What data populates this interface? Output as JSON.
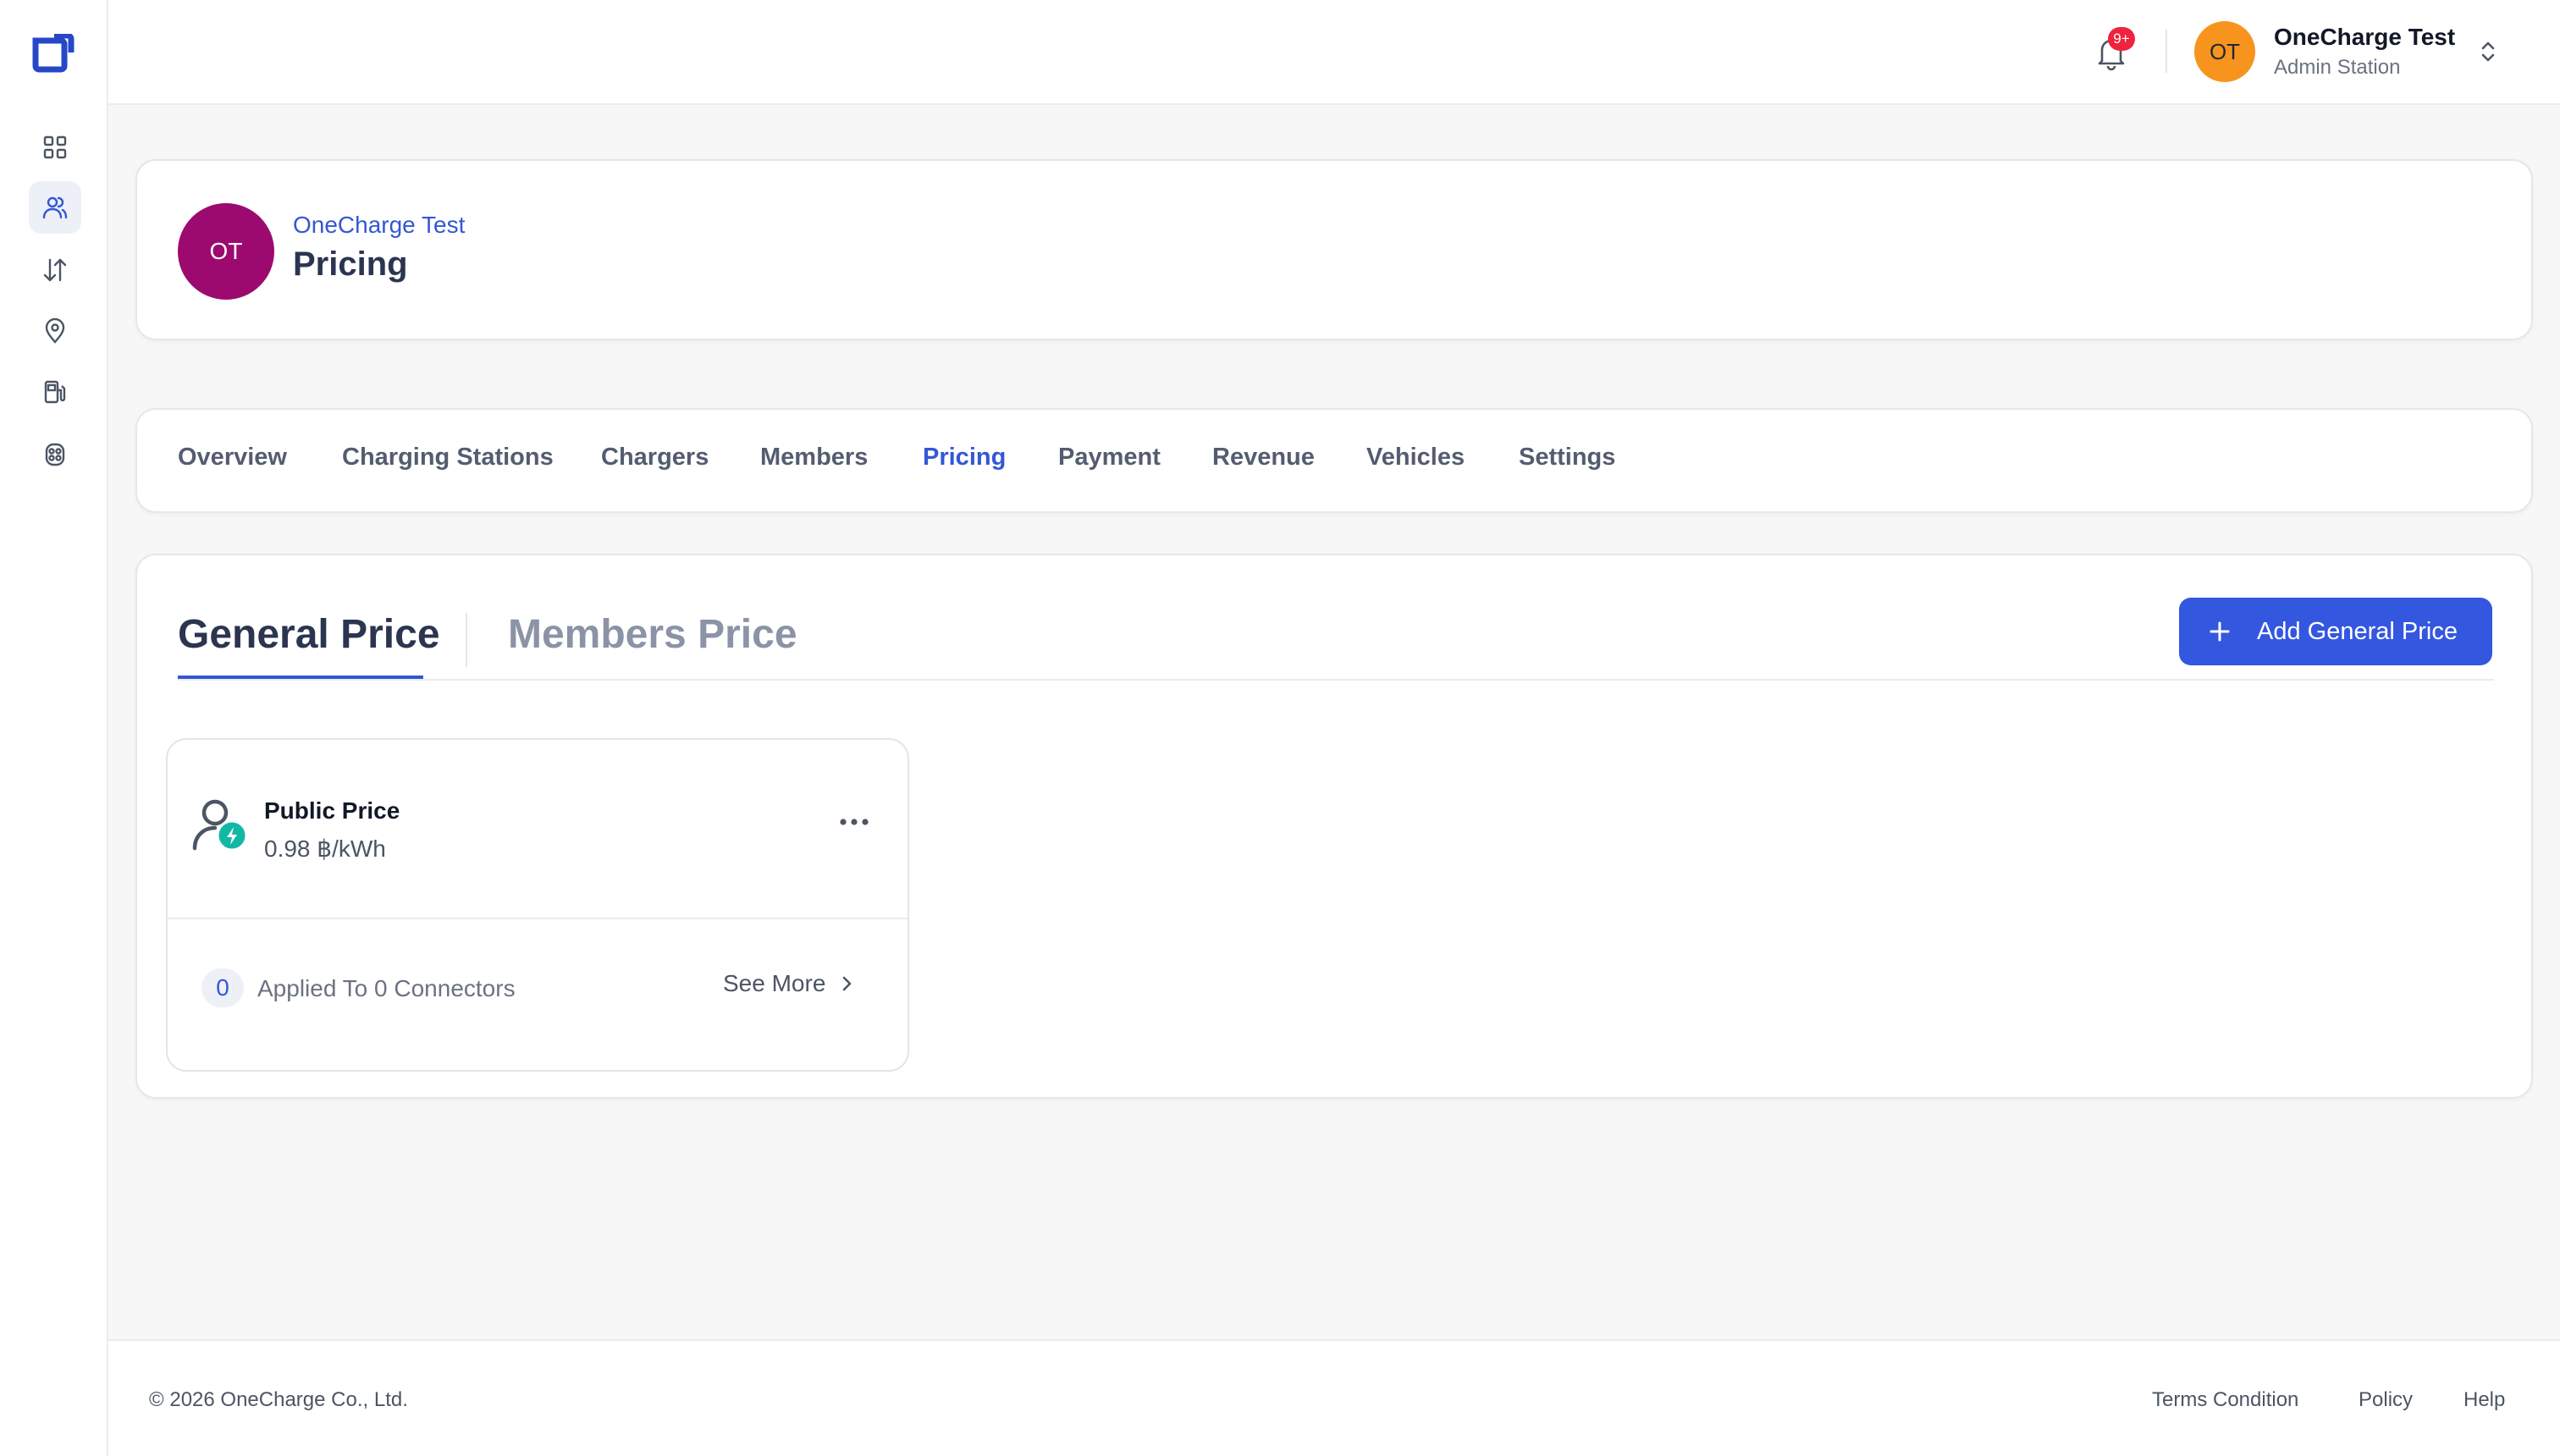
{
  "topbar": {
    "notification_badge": "9+",
    "user": {
      "initials": "OT",
      "name": "OneCharge Test",
      "role": "Admin Station"
    }
  },
  "header": {
    "initials": "OT",
    "org_name": "OneCharge Test",
    "title": "Pricing"
  },
  "tabs": [
    {
      "label": "Overview"
    },
    {
      "label": "Charging Stations"
    },
    {
      "label": "Chargers"
    },
    {
      "label": "Members"
    },
    {
      "label": "Pricing"
    },
    {
      "label": "Payment"
    },
    {
      "label": "Revenue"
    },
    {
      "label": "Vehicles"
    },
    {
      "label": "Settings"
    }
  ],
  "active_tab": "Pricing",
  "pricing": {
    "subtabs": [
      "General Price",
      "Members Price"
    ],
    "active_subtab": "General Price",
    "add_button_label": "Add General Price",
    "cards": [
      {
        "name": "Public Price",
        "value": "0.98 ฿/kWh",
        "connector_count": "0",
        "applied_text": "Applied To 0 Connectors",
        "see_more_label": "See More"
      }
    ]
  },
  "footer": {
    "copyright": "© 2026 OneCharge Co., Ltd.",
    "links": [
      "Terms Condition",
      "Policy",
      "Help"
    ]
  },
  "colors": {
    "accent": "#3457d5",
    "button": "#3457e0",
    "org_avatar": "#9c0a6f",
    "user_avatar": "#f7941d",
    "badge": "#ef233c",
    "price_icon_badge": "#12b8a6"
  }
}
